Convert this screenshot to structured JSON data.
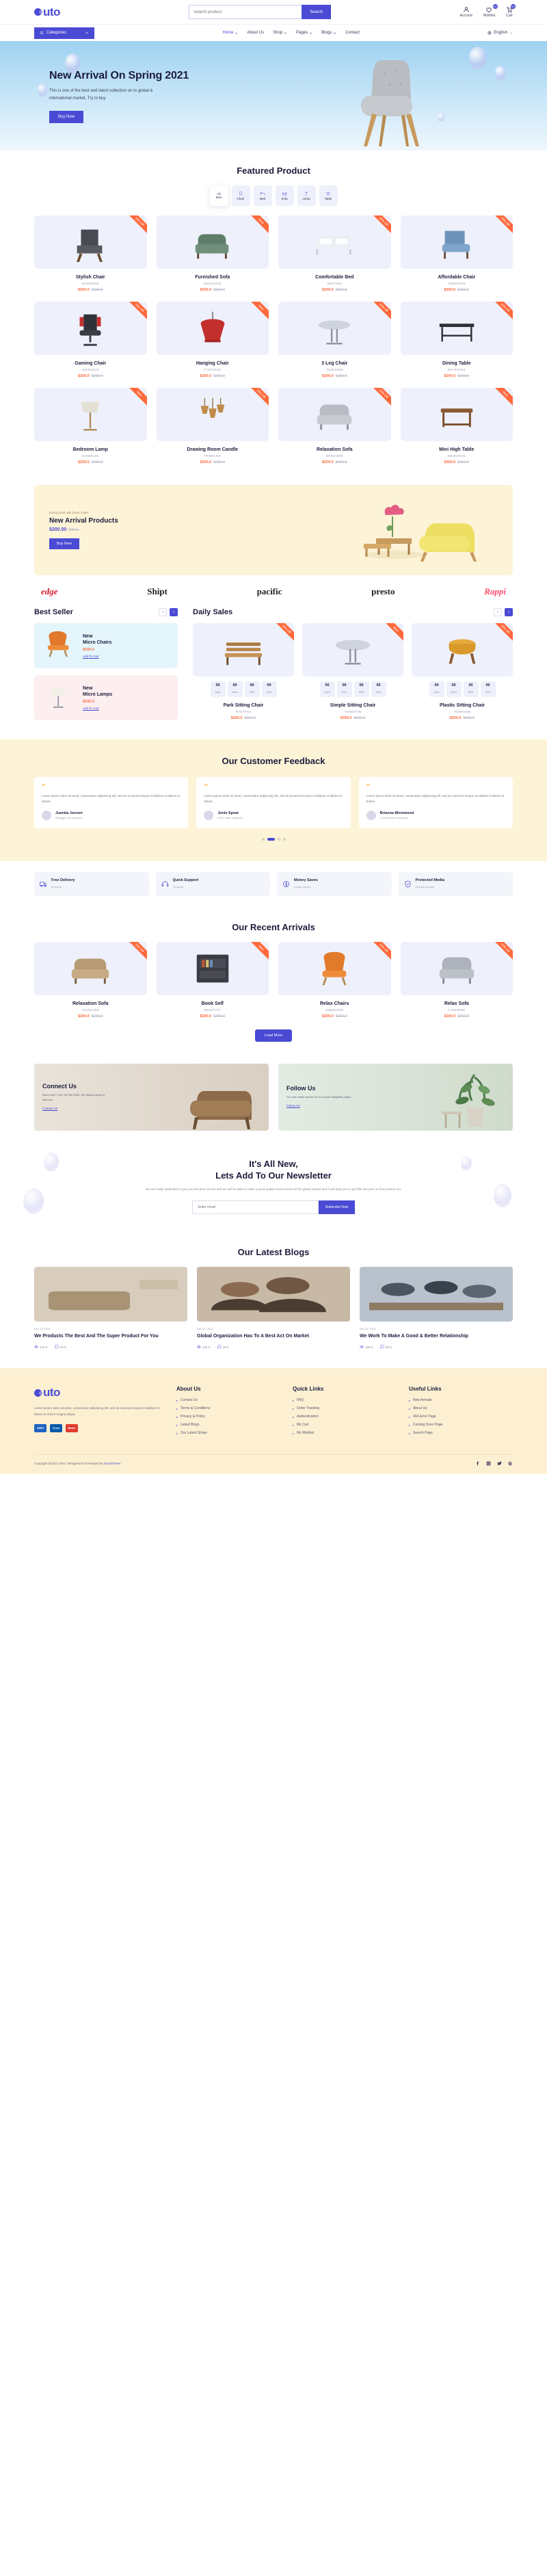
{
  "brand": {
    "name": "uto",
    "accent": "#4a4ad4",
    "orange": "#ff6a3d",
    "cream": "#fdf3d7"
  },
  "topbar": {
    "search_placeholder": "Search product",
    "search_button": "Search",
    "account_label": "Account",
    "wishlist_label": "Wishlist",
    "wishlist_count": "00",
    "cart_label": "Cart",
    "cart_count": "00"
  },
  "nav": {
    "categories_label": "Categories",
    "links": [
      {
        "label": "Home",
        "caret": true,
        "active": true
      },
      {
        "label": "About Us",
        "caret": false,
        "active": false
      },
      {
        "label": "Shop",
        "caret": true,
        "active": false
      },
      {
        "label": "Pages",
        "caret": true,
        "active": false
      },
      {
        "label": "Blogs",
        "caret": true,
        "active": false
      },
      {
        "label": "Contact",
        "caret": false,
        "active": false
      }
    ],
    "language": "English"
  },
  "hero": {
    "title": "New Arrival On Spring 2021",
    "text": "This is one of the best and latest collection on to global & international market. Try to buy.",
    "button": "Buy Now"
  },
  "featured": {
    "title": "Featured Product",
    "tabs": [
      {
        "label": "All Item",
        "icon": "all-icon",
        "active": true
      },
      {
        "label": "Chair",
        "icon": "chair-icon",
        "active": false
      },
      {
        "label": "Bed",
        "icon": "bed-icon",
        "active": false
      },
      {
        "label": "Sofa",
        "icon": "sofa-icon",
        "active": false
      },
      {
        "label": "Lamp",
        "icon": "lamp-icon",
        "active": false
      },
      {
        "label": "Table",
        "icon": "table-icon",
        "active": false
      }
    ],
    "products": [
      {
        "name": "Stylish Chair",
        "sku": "N23HN456",
        "new_price": "$200.0",
        "old_price": "$250.0",
        "ribbon": "10% Off",
        "img": "chair-dark"
      },
      {
        "name": "Furnished Sofa",
        "sku": "M45HG435",
        "new_price": "$200.0",
        "old_price": "$250.0",
        "ribbon": "New",
        "img": "sofa-green"
      },
      {
        "name": "Comfortable Bed",
        "sku": "B56TH56",
        "new_price": "$200.0",
        "old_price": "$250.0",
        "ribbon": "10% Off",
        "img": "bed-white"
      },
      {
        "name": "Affordable Chair",
        "sku": "TR56J8765",
        "new_price": "$200.0",
        "old_price": "$250.0",
        "ribbon": "15% Off",
        "img": "chair-blue"
      },
      {
        "name": "Gaming Chair",
        "sku": "HG45K6J5",
        "new_price": "$200.0",
        "old_price": "$250.0",
        "ribbon": "10% Off",
        "img": "chair-gaming"
      },
      {
        "name": "Hanging Chair",
        "sku": "TY67HG45",
        "new_price": "$200.0",
        "old_price": "$250.0",
        "ribbon": "New",
        "img": "chair-hanging"
      },
      {
        "name": "3 Leg Chair",
        "sku": "TH45SD89",
        "new_price": "$200.0",
        "old_price": "$250.0",
        "ribbon": "15% Off",
        "img": "table-round"
      },
      {
        "name": "Dining Table",
        "sku": "MK78GH54",
        "new_price": "$200.0",
        "old_price": "$250.0",
        "ribbon": "10% Off",
        "img": "table-dining"
      },
      {
        "name": "Bedroom Lamp",
        "sku": "GH45KL65",
        "new_price": "$200.0",
        "old_price": "$250.0",
        "ribbon": "New",
        "img": "lamp-floor"
      },
      {
        "name": "Drawing Room Candle",
        "sku": "PK89HJ56",
        "new_price": "$200.0",
        "old_price": "$250.0",
        "ribbon": "15% Off",
        "img": "lamp-pendant"
      },
      {
        "name": "Relaxation Sofa",
        "sku": "NF56HB89",
        "new_price": "$200.0",
        "old_price": "$250.0",
        "ribbon": "10% Off",
        "img": "sofa-grey"
      },
      {
        "name": "Mini High Table",
        "sku": "WE56HG45",
        "new_price": "$200.0",
        "old_price": "$250.0",
        "ribbon": "New",
        "img": "table-wood"
      }
    ]
  },
  "promo": {
    "eyebrow": "Exiting deal with finest outlet",
    "title": "New Arrival Products",
    "price": "$200.50",
    "old_price": "$250.0",
    "button": "Buy Now"
  },
  "brands": [
    {
      "name": "edge",
      "style": "edge"
    },
    {
      "name": "Shipt",
      "style": "plain"
    },
    {
      "name": "pacific",
      "style": "plain"
    },
    {
      "name": "presto",
      "style": "plain"
    },
    {
      "name": "Rappi",
      "style": "rappi"
    }
  ],
  "best_seller": {
    "title": "Best Seller",
    "items": [
      {
        "name": "New Micro Chairs",
        "price": "$150.0",
        "cart": "Add To Cart",
        "tone": "c1",
        "img": "chair-orange"
      },
      {
        "name": "New Micro Lamps",
        "price": "$150.0",
        "cart": "Add To Cart",
        "tone": "c2",
        "img": "lamp-small"
      }
    ]
  },
  "daily_sales": {
    "title": "Daily Sales",
    "countdown_labels": [
      "Days",
      "Hours",
      "Mins",
      "Secs"
    ],
    "items": [
      {
        "name": "Park Sitting Chair",
        "sku": "RG67FH4",
        "new_price": "$200.0",
        "old_price": "$250.0",
        "ribbon": "10% Off",
        "img": "bench-wood",
        "countdown": [
          "00",
          "00",
          "00",
          "00"
        ]
      },
      {
        "name": "Simple Sitting Chair",
        "sku": "TH65DF45",
        "new_price": "$200.0",
        "old_price": "$250.0",
        "ribbon": "New",
        "img": "table-round2",
        "countdown": [
          "00",
          "00",
          "00",
          "00"
        ]
      },
      {
        "name": "Plastic Sitting Chair",
        "sku": "HG98HJ56",
        "new_price": "$200.0",
        "old_price": "$250.0",
        "ribbon": "15% Off",
        "img": "stool-yellow",
        "countdown": [
          "00",
          "00",
          "00",
          "00"
        ]
      }
    ]
  },
  "feedback": {
    "title": "Our Customer Feedback",
    "cards": [
      {
        "text": "Lorem ipsum dolor sit amet, consectetur adipiscing elit, sed do eiusmod tempor incididunt ut labore et dolore.",
        "name": "Juanita Jensen",
        "role": "Manager, eCommerce"
      },
      {
        "text": "Lorem ipsum dolor sit amet, consectetur adipiscing elit, sed do eiusmod tempor incididunt ut labore et dolore.",
        "name": "Jenie Spear",
        "role": "CEO, Web company"
      },
      {
        "text": "Lorem ipsum dolor sit amet, consectetur adipiscing elit, sed do eiusmod tempor incididunt ut labore et dolore.",
        "name": "Brianna Morewood",
        "role": "E-Commerce specialist"
      }
    ]
  },
  "features": [
    {
      "title": "Free Delivery",
      "sub": "At home",
      "icon": "truck-icon"
    },
    {
      "title": "Quick Support",
      "sub": "24 hours",
      "icon": "headset-icon"
    },
    {
      "title": "Money Saves",
      "sub": "Amply earned",
      "icon": "coin-icon"
    },
    {
      "title": "Protected Media",
      "sub": "Ensure security",
      "icon": "shield-icon"
    }
  ],
  "recent": {
    "title": "Our Recent Arrivals",
    "load_more": "Load More",
    "products": [
      {
        "name": "Relaxation Sofa",
        "sku": "HG45HJ56",
        "new_price": "$200.0",
        "old_price": "$250.0",
        "ribbon": "10% Off",
        "img": "sofa-tan"
      },
      {
        "name": "Book Self",
        "sku": "RE56TY67",
        "new_price": "$200.0",
        "old_price": "$250.0",
        "ribbon": "New",
        "img": "shelf-dark"
      },
      {
        "name": "Relax Chairs",
        "sku": "MB56HG45",
        "new_price": "$200.0",
        "old_price": "$250.0",
        "ribbon": "15% Off",
        "img": "chair-orange2"
      },
      {
        "name": "Relax Sofa",
        "sku": "TH45DB89",
        "new_price": "$200.0",
        "old_price": "$250.0",
        "ribbon": "10% Off",
        "img": "sofa-grey2"
      }
    ]
  },
  "connect": {
    "left": {
      "title": "Connect Us",
      "text": "Need help? Call +00 000 0000. We always ready to help you.",
      "link": "Contact Us"
    },
    "right": {
      "title": "Follow Us",
      "text": "You can easily connect to our social Instagram pages.",
      "link": "Follow Us"
    }
  },
  "newsletter": {
    "title_line1": "It's All New,",
    "title_line2": "Lets Add To Our Newsletter",
    "text": "We are really dedicated to give you the best service and we will be able to make a good quality environment on the global market and it will help you to get little discount on first product too.",
    "placeholder": "Enter email",
    "button": "Subscribe Now"
  },
  "blogs": {
    "title": "Our Latest Blogs",
    "posts": [
      {
        "date": "Nov 20, 2021",
        "title": "We Products The Best And The Super Product For You",
        "views": "122 K",
        "comments": "23 K",
        "img": "blog-living"
      },
      {
        "date": "Nov 22, 2021",
        "title": "Global Organization Has To A Best Act On Market",
        "views": "133 K",
        "comments": "45 K",
        "img": "blog-people"
      },
      {
        "date": "Nov 24, 2021",
        "title": "We Work To Make A Good & Better Relationship",
        "views": "156 K",
        "comments": "29 K",
        "img": "blog-office"
      }
    ]
  },
  "footer": {
    "about_text": "Lorem ipsum dolor sit amet, consectetur adipiscing elit, sed do eiusmod tempor incididunt ut labore et dolore magna aliqua.",
    "cards": [
      "AMEX",
      "Cirrus",
      "MasterCard"
    ],
    "columns": [
      {
        "heading": "About Us",
        "links": [
          "Contact Us",
          "Terms & Conditions",
          "Privacy & Policy",
          "Latest Blogs",
          "Our Latest Shops"
        ]
      },
      {
        "heading": "Quick Links",
        "links": [
          "FAQ",
          "Order Tracking",
          "Authentication",
          "My Cart",
          "My Wishlist"
        ]
      },
      {
        "heading": "Useful Links",
        "links": [
          "New Arrivals",
          "About Us",
          "404 Error Page",
          "Coming Soon Page",
          "Search Page"
        ]
      }
    ],
    "copyright_pre": "Copyright @2021 Outo. Designed & Developed By ",
    "copyright_link": "EnvyTheme",
    "socials": [
      "facebook-icon",
      "instagram-icon",
      "twitter-icon",
      "pinterest-icon"
    ]
  }
}
